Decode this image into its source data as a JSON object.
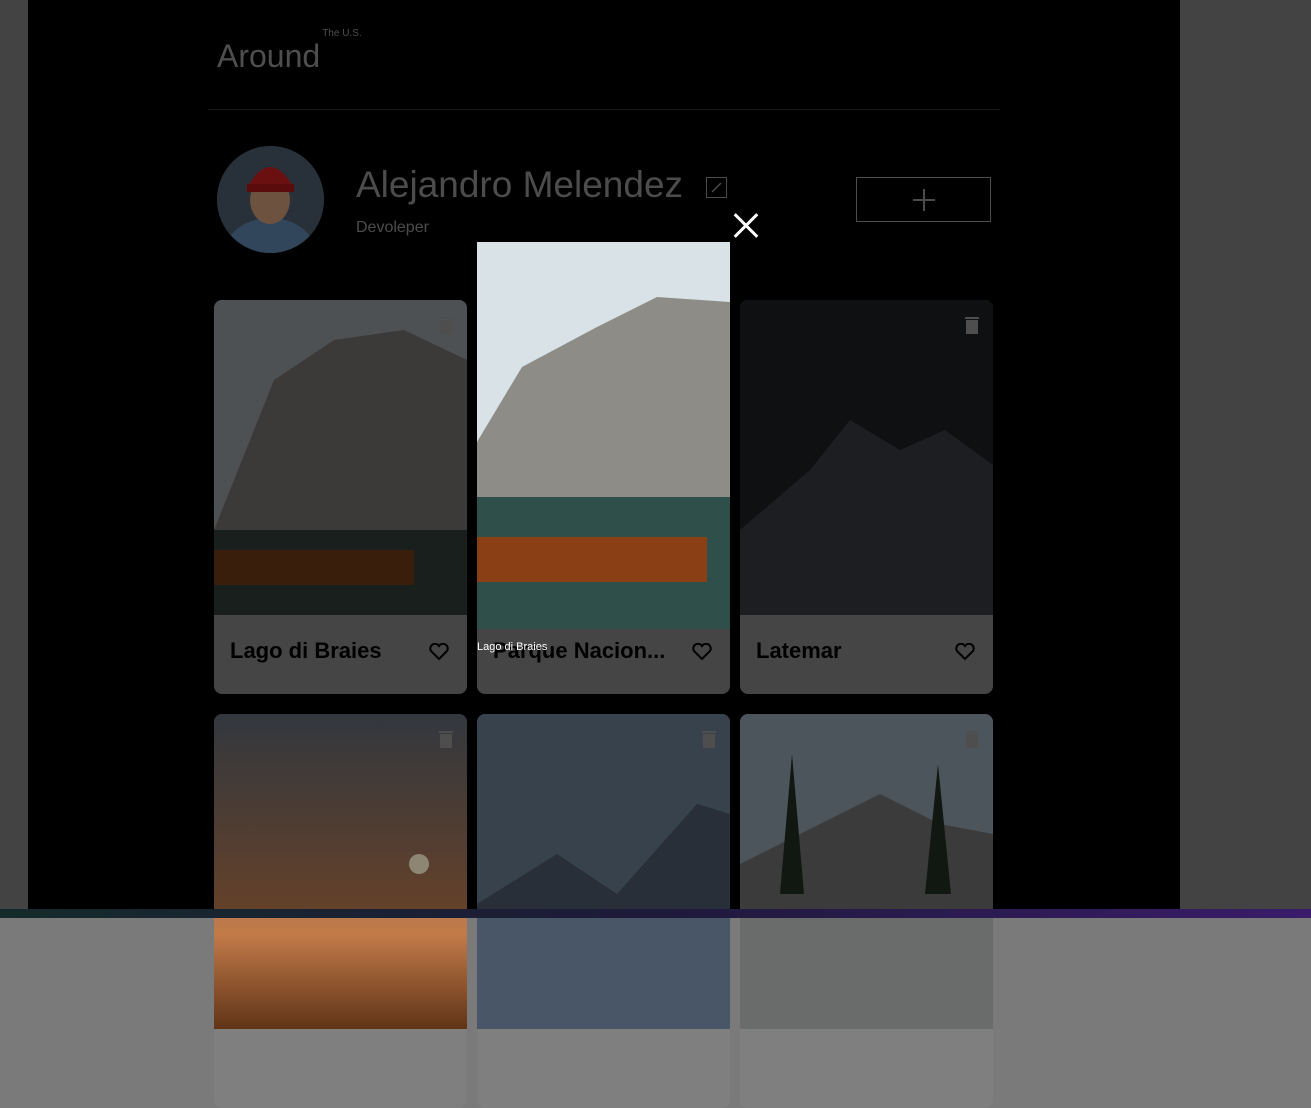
{
  "header": {
    "logo": "Around",
    "logo_superscript": "The U.S."
  },
  "profile": {
    "name": "Alejandro Melendez",
    "job": "Devoleper"
  },
  "cards": [
    {
      "title": "Lago di Braies"
    },
    {
      "title": "Parque Nacion..."
    },
    {
      "title": "Latemar"
    },
    {
      "title": ""
    },
    {
      "title": ""
    },
    {
      "title": ""
    }
  ],
  "popup": {
    "caption": "Lago di Braies"
  },
  "icons": {
    "edit": "pencil-icon",
    "add": "plus-icon",
    "like": "heart-icon",
    "delete": "trash-icon",
    "close": "close-icon"
  },
  "colors": {
    "overlay": "#000000",
    "card": "#7f7f7f"
  }
}
